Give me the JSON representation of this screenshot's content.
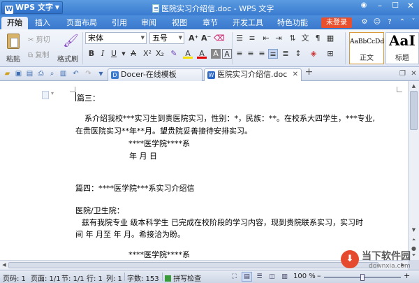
{
  "titlebar": {
    "app_name": "WPS 文字",
    "window_title": "医院实习介绍信.doc - WPS 文字"
  },
  "menu": {
    "tabs": [
      "开始",
      "插入",
      "页面布局",
      "引用",
      "审阅",
      "视图",
      "章节",
      "开发工具",
      "特色功能"
    ],
    "login_label": "未登录"
  },
  "ribbon": {
    "paste_label": "粘贴",
    "cut_label": "剪切",
    "copy_label": "复制",
    "format_painter_label": "格式刷",
    "font_name": "宋体",
    "font_size": "五号",
    "style_normal_sample": "AaBbCcDd",
    "style_normal_label": "正文",
    "style_heading_sample": "AaI",
    "style_heading_label": "标题"
  },
  "tabs": {
    "docer_tab": "Docer-在线模板",
    "doc_tab": "医院实习介绍信.doc",
    "new_tab": "+"
  },
  "document": {
    "lines": [
      "篇三：",
      "系介绍我校***实习生到贵医院实习，性别：*，民族：**。在校系大四学生，***专业,",
      "在贵医院实习**年**月。望贵院妥善接待安排实习。",
      "****医学院****系",
      "年  月  日",
      "篇四：****医学院***系实习介绍信",
      "医院/卫生院：",
      "兹有我院专业    级本科学生    已完成在校阶段的学习内容，现到贵院联系实习，实习时",
      "间  年  月至  年  月。希接洽为盼。",
      "****医学院****系"
    ]
  },
  "status": {
    "page_code": "页码: 1",
    "page": "页面: 1/1",
    "section": "节: 1/1",
    "row": "行: 1",
    "col": "列: 1",
    "word_count": "字数: 153",
    "spell_check": "拼写检查",
    "zoom": "100 %",
    "zoom_level_percent": 50
  },
  "watermark": {
    "text_cn": "当下软件园",
    "text_en": "downxia.com"
  }
}
